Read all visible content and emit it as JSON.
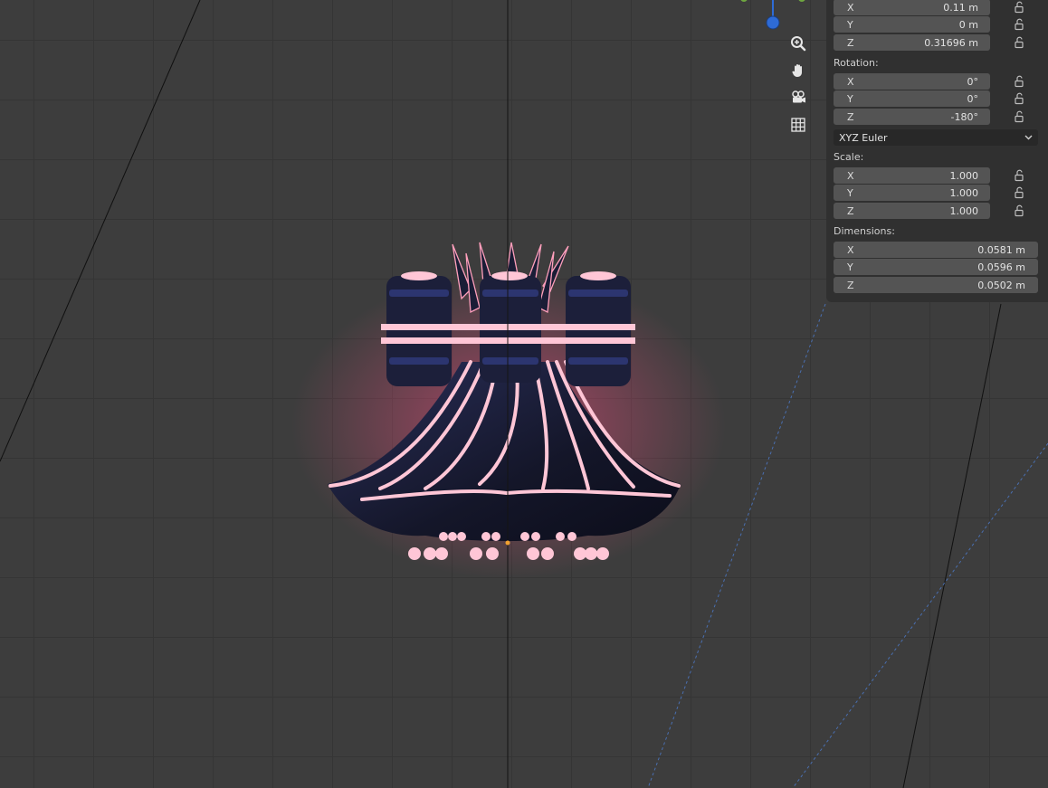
{
  "panel": {
    "location": {
      "x": {
        "axis": "X",
        "value": "0.11 m"
      },
      "y": {
        "axis": "Y",
        "value": "0 m"
      },
      "z": {
        "axis": "Z",
        "value": "0.31696 m"
      }
    },
    "rotation": {
      "label": "Rotation:",
      "x": {
        "axis": "X",
        "value": "0°"
      },
      "y": {
        "axis": "Y",
        "value": "0°"
      },
      "z": {
        "axis": "Z",
        "value": "-180°"
      },
      "mode": "XYZ Euler"
    },
    "scale": {
      "label": "Scale:",
      "x": {
        "axis": "X",
        "value": "1.000"
      },
      "y": {
        "axis": "Y",
        "value": "1.000"
      },
      "z": {
        "axis": "Z",
        "value": "1.000"
      }
    },
    "dimensions": {
      "label": "Dimensions:",
      "x": {
        "axis": "X",
        "value": "0.0581 m"
      },
      "y": {
        "axis": "Y",
        "value": "0.0596 m"
      },
      "z": {
        "axis": "Z",
        "value": "0.0502 m"
      }
    }
  },
  "navigation": {
    "icons": [
      "zoom-icon",
      "hand-pan-icon",
      "camera-view-icon",
      "grid-perspective-icon"
    ]
  },
  "colors": {
    "viewport_bg": "#3d3d3d",
    "grid_line": "#353535",
    "panel_bg": "#303030",
    "field_bg": "#545454",
    "glow_pink": "#ffc6d6",
    "model_navy": "#1c1f3a",
    "gizmo_blue": "#2e6bd6"
  }
}
